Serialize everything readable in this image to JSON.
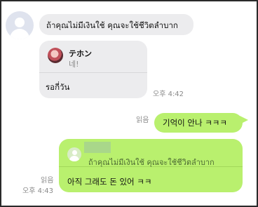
{
  "chat": {
    "msg1": {
      "text": "ถ้าคุณไม่มีเงินใช้ คุณจะใช้ชีวิตลำบาก"
    },
    "msg2": {
      "quote_name": "テホン",
      "quote_text": "네!",
      "reply": "รอกี่วัน",
      "time": "오후 4:42"
    },
    "msg3": {
      "read": "읽음",
      "text": "기억이 안나 ㅋㅋㅋ"
    },
    "msg4": {
      "quote_text": "ถ้าคุณไม่มีเงินใช้ คุณจะใช้ชีวิตลำบาก",
      "reply": "아직 그래도 돈 있어 ㅋㅋ",
      "read": "읽음",
      "time": "오후 4:43"
    }
  }
}
